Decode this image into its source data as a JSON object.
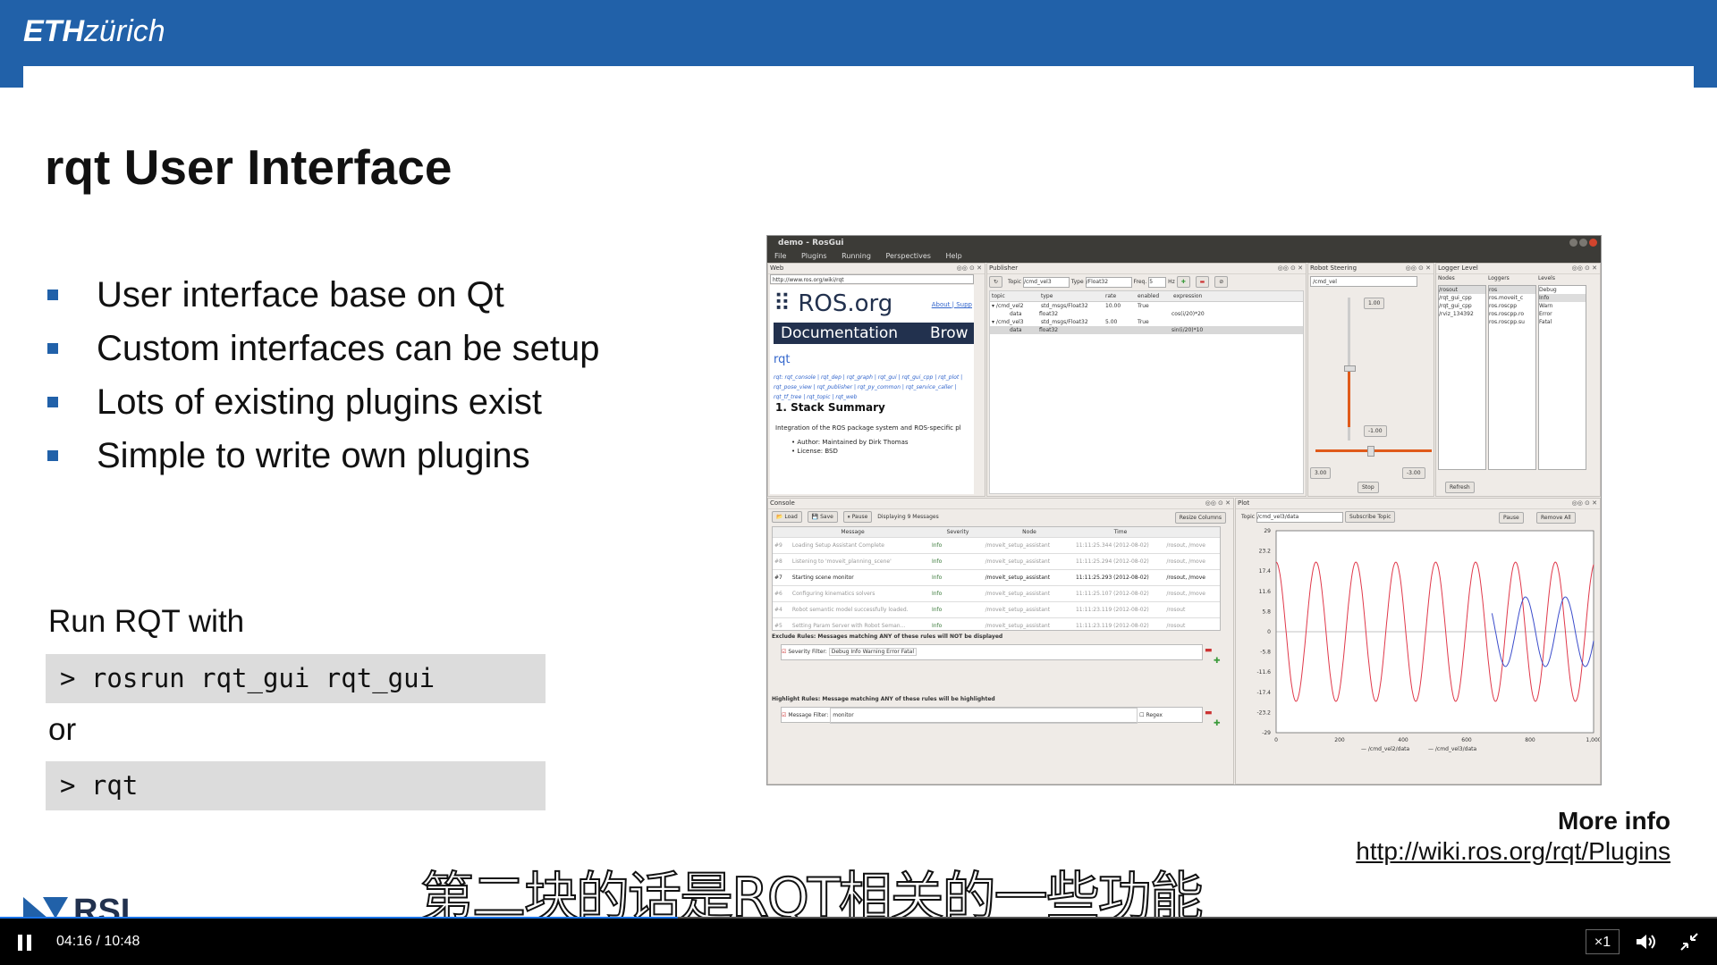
{
  "header": {
    "logo_bold": "ETH",
    "logo_rest": "zürich",
    "brand_color": "#2161a9"
  },
  "slide": {
    "title": "rqt User Interface",
    "bullets": [
      "User interface base on Qt",
      "Custom interfaces can be setup",
      "Lots of existing plugins exist",
      "Simple to write own plugins"
    ],
    "run_label": "Run RQT with",
    "command1": "> rosrun rqt_gui rqt_gui",
    "or_label": "or",
    "command2": "> rqt",
    "more_info_label": "More info",
    "more_info_link": "http://wiki.ros.org/rqt/Plugins"
  },
  "subtitle": "第二块的话是RQT相关的一些功能",
  "rosgui": {
    "window_title": "demo - RosGui",
    "menu": [
      "File",
      "Plugins",
      "Running",
      "Perspectives",
      "Help"
    ],
    "web": {
      "pane_title": "Web",
      "url": "http://www.ros.org/wiki/rqt",
      "site_name": "ROS.org",
      "top_links": "About | Supp",
      "nav_doc": "Documentation",
      "nav_browse": "Brow",
      "page_heading": "rqt",
      "pkg_links": "rqt: rqt_console | rqt_dep | rqt_graph | rqt_gui | rqt_gui_cpp | rqt_plot | rqt_pose_view | rqt_publisher | rqt_py_common | rqt_service_caller | rqt_tf_tree | rqt_topic | rqt_web",
      "stack_summary": "1. Stack Summary",
      "stack_desc": "Integration of the ROS package system and ROS-specific pl",
      "author": "Author: Maintained by Dirk Thomas",
      "license": "License: BSD"
    },
    "publisher": {
      "pane_title": "Publisher",
      "topic_label": "Topic",
      "topic_value": "/cmd_vel3",
      "type_label": "Type",
      "type_value": "/Float32",
      "freq_label": "Freq.",
      "freq_value": "5",
      "hz_label": "Hz",
      "columns": [
        "topic",
        "type",
        "rate",
        "enabled",
        "expression"
      ],
      "rows": [
        [
          "▾ /cmd_vel2",
          "std_msgs/Float32",
          "10.00",
          "True",
          ""
        ],
        [
          "data",
          "float32",
          "",
          "",
          "cos(i/20)*20"
        ],
        [
          "▾ /cmd_vel3",
          "std_msgs/Float32",
          "5.00",
          "True",
          ""
        ],
        [
          "data",
          "float32",
          "",
          "",
          "sin(i/20)*10"
        ]
      ]
    },
    "steering": {
      "pane_title": "Robot Steering",
      "topic": "/cmd_vel",
      "v_max": "1.00",
      "v_min": "-1.00",
      "left_val": "3.00",
      "right_val": "-3.00",
      "stop_label": "Stop"
    },
    "logger": {
      "pane_title": "Logger Level",
      "col_nodes": "Nodes",
      "col_loggers": "Loggers",
      "col_levels": "Levels",
      "nodes": [
        "/rosout",
        "/rqt_gui_cpp",
        "/rqt_gui_cpp",
        "/rviz_134392"
      ],
      "loggers": [
        "ros",
        "ros.moveit_c",
        "ros.roscpp",
        "ros.roscpp.ro",
        "ros.roscpp.su"
      ],
      "levels": [
        "Debug",
        "Info",
        "Warn",
        "Error",
        "Fatal"
      ],
      "refresh_label": "Refresh"
    },
    "console": {
      "pane_title": "Console",
      "load_label": "Load",
      "save_label": "Save",
      "pause_label": "Pause",
      "displaying": "Displaying 9 Messages",
      "resize_label": "Resize Columns",
      "columns": [
        "Message",
        "Severity",
        "Node",
        "Time"
      ],
      "rows": [
        {
          "id": "#9",
          "msg": "Loading Setup Assistant Complete",
          "sev": "Info",
          "node": "/moveit_setup_assistant",
          "time": "11:11:25.344 (2012-08-02)",
          "topics": "/rosout, /move"
        },
        {
          "id": "#8",
          "msg": "Listening to 'moveit_planning_scene'",
          "sev": "Info",
          "node": "/moveit_setup_assistant",
          "time": "11:11:25.294 (2012-08-02)",
          "topics": "/rosout, /move"
        },
        {
          "id": "#7",
          "msg": "Starting scene monitor",
          "sev": "Info",
          "node": "/moveit_setup_assistant",
          "time": "11:11:25.293 (2012-08-02)",
          "topics": "/rosout, /move"
        },
        {
          "id": "#6",
          "msg": "Configuring kinematics solvers",
          "sev": "Info",
          "node": "/moveit_setup_assistant",
          "time": "11:11:25.107 (2012-08-02)",
          "topics": "/rosout, /move"
        },
        {
          "id": "#4",
          "msg": "Robot semantic model successfully loaded.",
          "sev": "Info",
          "node": "/moveit_setup_assistant",
          "time": "11:11:23.119 (2012-08-02)",
          "topics": "/rosout"
        },
        {
          "id": "#5",
          "msg": "Setting Param Server with Robot Seman...",
          "sev": "Info",
          "node": "/moveit_setup_assistant",
          "time": "11:11:23.119 (2012-08-02)",
          "topics": "/rosout"
        }
      ],
      "exclude_heading": "Exclude Rules: Messages matching ANY of these rules will NOT be displayed",
      "severity_filter_label": "Severity Filter:",
      "severity_filter_values": "Debug  Info  Warning  Error  Fatal",
      "highlight_heading": "Highlight Rules: Message matching ANY of these rules will be highlighted",
      "message_filter_label": "Message Filter:",
      "message_filter_value": "monitor",
      "regex_label": "Regex"
    },
    "plot": {
      "pane_title": "Plot",
      "topic_label": "Topic",
      "topic_value": "/cmd_vel3/data",
      "subscribe_label": "Subscribe Topic",
      "pause_label": "Pause",
      "remove_all_label": "Remove All",
      "y_ticks": [
        "29",
        "23.2",
        "17.4",
        "11.6",
        "5.8",
        "0",
        "-5.8",
        "-11.6",
        "-17.4",
        "-23.2",
        "-29"
      ],
      "x_ticks": [
        "0",
        "200",
        "400",
        "600",
        "800",
        "1,000"
      ],
      "legend": [
        "/cmd_vel2/data",
        "/cmd_vel3/data"
      ],
      "colors": {
        "vel2": "#e0384a",
        "vel3": "#3b4ccb"
      }
    }
  },
  "player": {
    "time_current": "04:16",
    "time_total": "10:48",
    "progress": 0.395,
    "speed": "×1",
    "accent": "#1a73e8"
  }
}
